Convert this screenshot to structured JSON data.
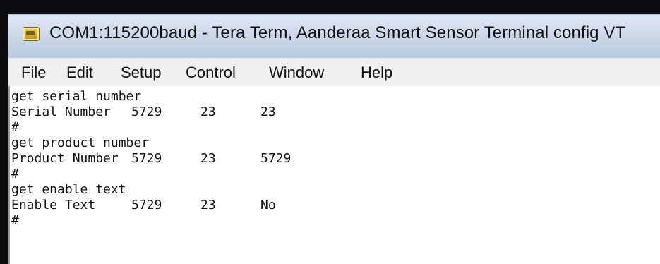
{
  "window": {
    "title": "COM1:115200baud - Tera Term, Aanderaa Smart Sensor Terminal config VT",
    "icon": "teraterm-app-icon"
  },
  "menu": {
    "items": [
      "File",
      "Edit",
      "Setup",
      "Control",
      "Window",
      "Help"
    ]
  },
  "terminal": {
    "lines": [
      {
        "text": "get serial number"
      },
      {
        "label": "Serial Number",
        "col2": "5729",
        "col3": "23",
        "col4": "23"
      },
      {
        "text": "#"
      },
      {
        "text": "get product number"
      },
      {
        "label": "Product Number",
        "col2": "5729",
        "col3": "23",
        "col4": "5729"
      },
      {
        "text": "#"
      },
      {
        "text": "get enable text"
      },
      {
        "label": "Enable Text",
        "col2": "5729",
        "col3": "23",
        "col4": "No"
      },
      {
        "text": "#"
      }
    ]
  }
}
